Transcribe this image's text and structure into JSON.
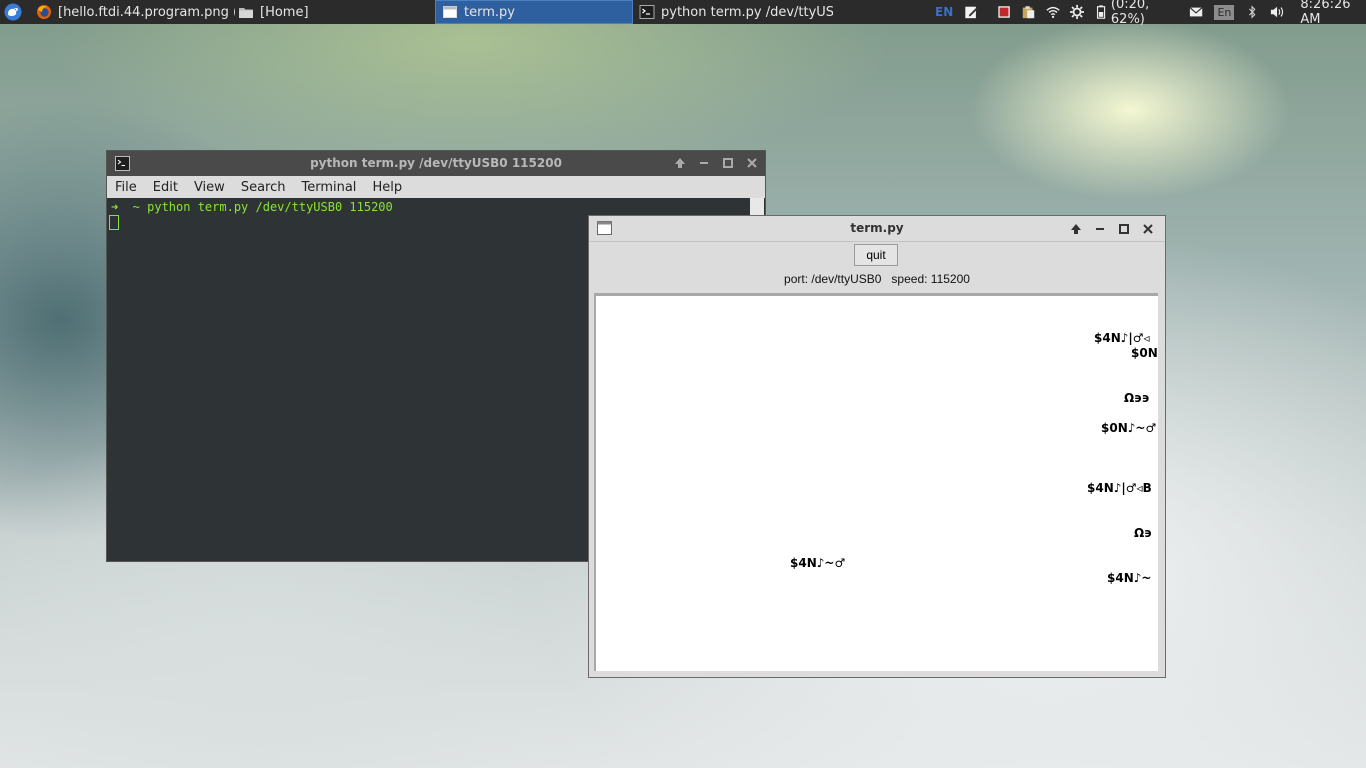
{
  "taskbar": {
    "tasks": [
      {
        "label": "[hello.ftdi.44.program.png (…",
        "icon": "firefox-icon"
      },
      {
        "label": "[Home]",
        "icon": "folder-icon"
      },
      {
        "label": "term.py",
        "icon": "window-icon"
      },
      {
        "label": "python term.py /dev/ttyUS…",
        "icon": "terminal-icon"
      }
    ],
    "keyboard_layout": "EN",
    "input_method": "En",
    "battery": "(0:20, 62%)",
    "clock": "8:26:26 AM"
  },
  "terminal": {
    "title": "python term.py /dev/ttyUSB0 115200",
    "menu": [
      "File",
      "Edit",
      "View",
      "Search",
      "Terminal",
      "Help"
    ],
    "prompt": "➜  ~ python term.py /dev/ttyUSB0 115200"
  },
  "termpy": {
    "title": "term.py",
    "quit_label": "quit",
    "port_info": "port: /dev/ttyUSB0   speed: 115200",
    "output_lines": [
      "$4N♪|♂◃",
      "$0N",
      "Ω϶϶",
      "$0N♪~♂",
      "$4N♪|♂◃B",
      "Ω϶",
      "$4N♪~♂",
      "$4N♪~"
    ]
  },
  "colors": {
    "panel_bg": "#2b2b2b",
    "active_task": "#2e5f9e",
    "terminal_bg": "#2e3436",
    "terminal_fg": "#8ae234"
  }
}
